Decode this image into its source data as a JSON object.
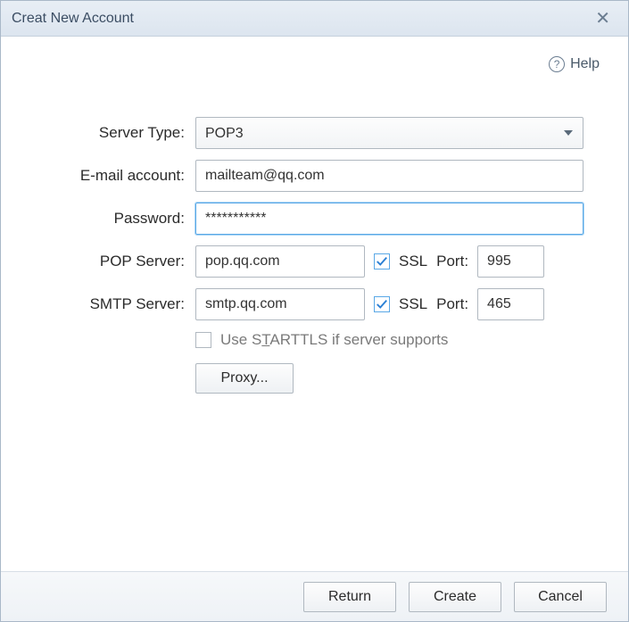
{
  "window": {
    "title": "Creat New Account"
  },
  "help": {
    "label": "Help"
  },
  "form": {
    "serverType": {
      "label": "Server Type:",
      "value": "POP3",
      "options": [
        "POP3"
      ]
    },
    "email": {
      "label": "E-mail account:",
      "value": "mailteam@qq.com"
    },
    "password": {
      "label": "Password:",
      "value": "***********"
    },
    "pop": {
      "label": "POP Server:",
      "value": "pop.qq.com",
      "ssl_label": "SSL",
      "ssl_checked": true,
      "port_label": "Port:",
      "port": "995"
    },
    "smtp": {
      "label": "SMTP Server:",
      "value": "smtp.qq.com",
      "ssl_label": "SSL",
      "ssl_checked": true,
      "port_label": "Port:",
      "port": "465"
    },
    "starttls": {
      "prefix": "Use S",
      "ul": "T",
      "suffix": "ARTTLS if server supports",
      "checked": false
    },
    "proxy": {
      "label": "Proxy..."
    }
  },
  "footer": {
    "return": "Return",
    "create": "Create",
    "cancel": "Cancel"
  }
}
